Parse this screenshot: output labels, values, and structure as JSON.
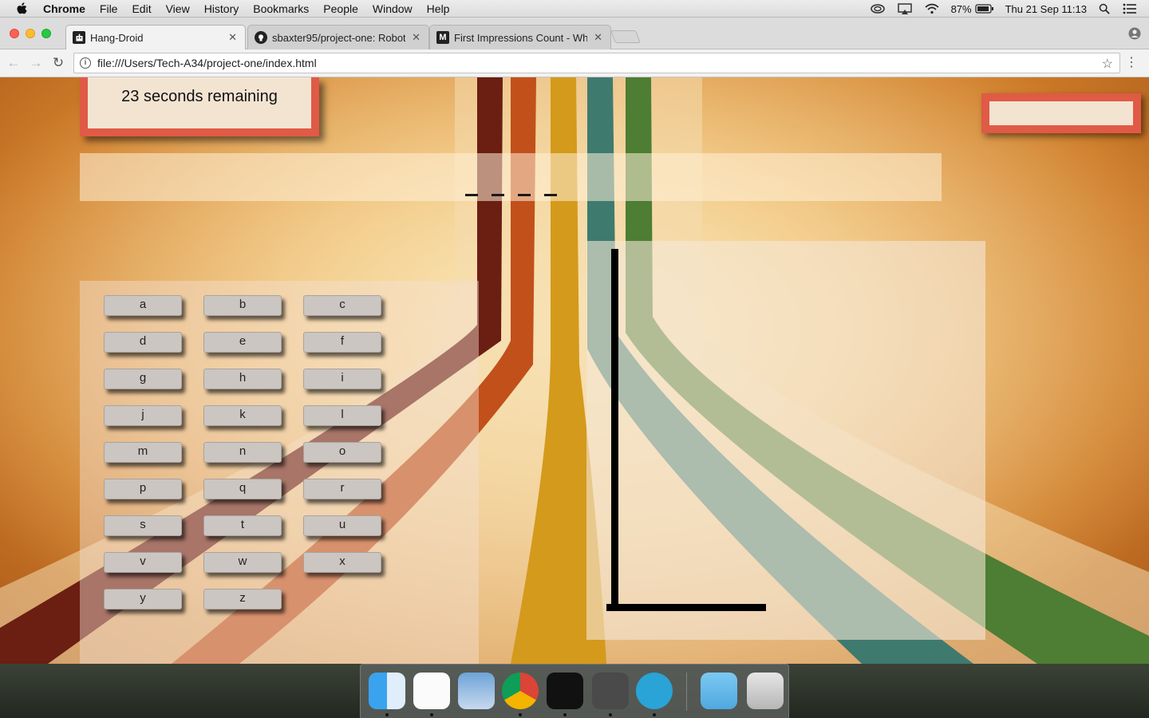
{
  "menubar": {
    "app_name": "Chrome",
    "menus": [
      "File",
      "Edit",
      "View",
      "History",
      "Bookmarks",
      "People",
      "Window",
      "Help"
    ],
    "battery": "87%",
    "clock": "Thu 21 Sep  11:13"
  },
  "tabs": [
    {
      "title": "Hang-Droid",
      "favicon": "robot-favicon"
    },
    {
      "title": "sbaxter95/project-one: Robot",
      "favicon": "github-favicon"
    },
    {
      "title": "First Impressions Count - Why",
      "favicon": "medium-favicon"
    }
  ],
  "favicon_letters": {
    "medium": "M"
  },
  "address_bar": {
    "url": "file:///Users/Tech-A34/project-one/index.html"
  },
  "game": {
    "timer_text": "23 seconds remaining",
    "score_text": "",
    "word_blank_count": 4,
    "letters": [
      "a",
      "b",
      "c",
      "d",
      "e",
      "f",
      "g",
      "h",
      "i",
      "j",
      "k",
      "l",
      "m",
      "n",
      "o",
      "p",
      "q",
      "r",
      "s",
      "t",
      "u",
      "v",
      "w",
      "x",
      "y",
      "z"
    ]
  },
  "dock": {
    "apps": [
      "finder",
      "slack",
      "preview",
      "chrome",
      "terminal",
      "sublime-text",
      "markdown-editor",
      "downloads-folder",
      "trash"
    ]
  },
  "colors": {
    "accent_red": "#e05a45",
    "panel_cream": "#f3e4d2",
    "key_gray": "#cbc6c1"
  }
}
